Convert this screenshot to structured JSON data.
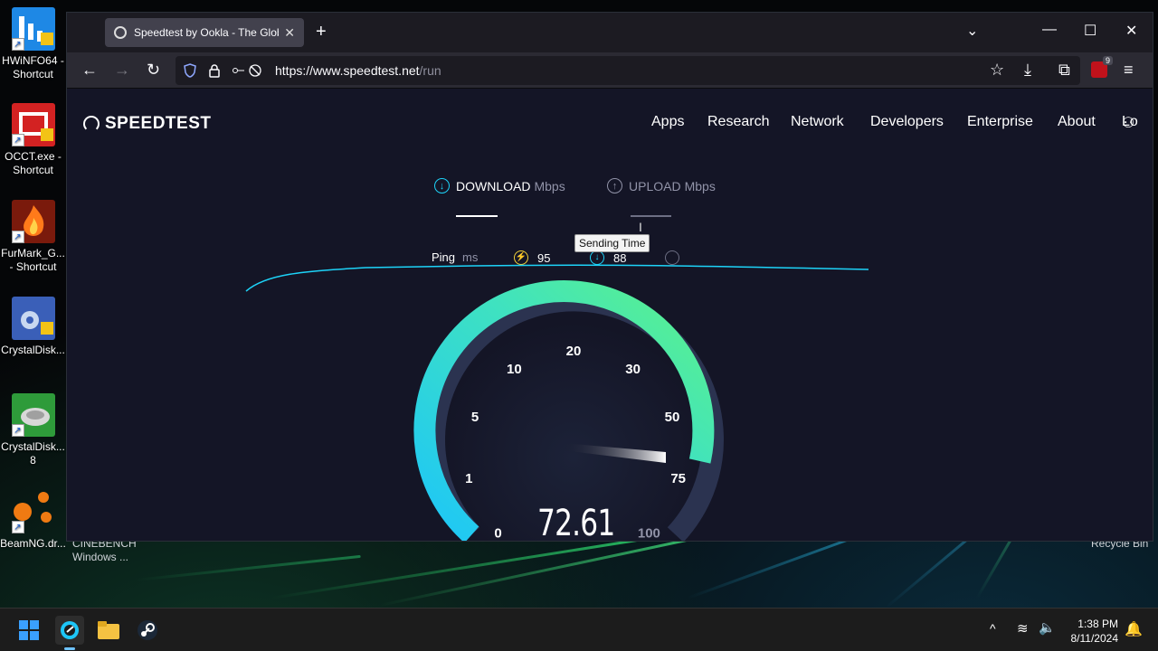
{
  "desktop": {
    "icons": [
      {
        "label": "HWiNFO64 - Shortcut",
        "icon": "hwinfo-icon"
      },
      {
        "label": "OCCT.exe - Shortcut",
        "icon": "occt-icon"
      },
      {
        "label": "FurMark_G... - Shortcut",
        "icon": "furmark-icon"
      },
      {
        "label": "CrystalDisk...",
        "icon": "crystaldiskinfo-icon"
      },
      {
        "label": "CrystalDisk... 8",
        "icon": "crystaldiskmark-icon"
      },
      {
        "label": "BeamNG.dr...",
        "icon": "beamng-icon"
      }
    ],
    "background_labels": {
      "cinebench": "CINEBENCH Windows ...",
      "recycle_bin": "Recycle Bin"
    }
  },
  "browser": {
    "tab_title": "Speedtest by Ookla - The Global",
    "url_host": "https://www.speedtest.net",
    "url_path": "/run",
    "extension_badge": "9"
  },
  "speedtest": {
    "logo": "SPEEDTEST",
    "nav": [
      "Apps",
      "Research",
      "Network",
      "Developers",
      "Enterprise",
      "About",
      "Lo"
    ],
    "download_label": "DOWNLOAD",
    "upload_label": "UPLOAD",
    "unit": "Mbps",
    "ping_label": "Ping",
    "ping_unit": "ms",
    "ping_idle": "95",
    "ping_download": "88",
    "tooltip": "Sending Time",
    "gauge_ticks": [
      "0",
      "1",
      "5",
      "10",
      "20",
      "30",
      "50",
      "75",
      "100"
    ],
    "current_speed": "72.61",
    "current_speed_value": 72.61,
    "accent_cyan": "#1dd3f8",
    "accent_green": "#5cf28a"
  },
  "taskbar": {
    "time": "1:38 PM",
    "date": "8/11/2024",
    "apps": [
      "start-icon",
      "firefox-icon",
      "file-explorer-icon",
      "steam-icon"
    ]
  }
}
